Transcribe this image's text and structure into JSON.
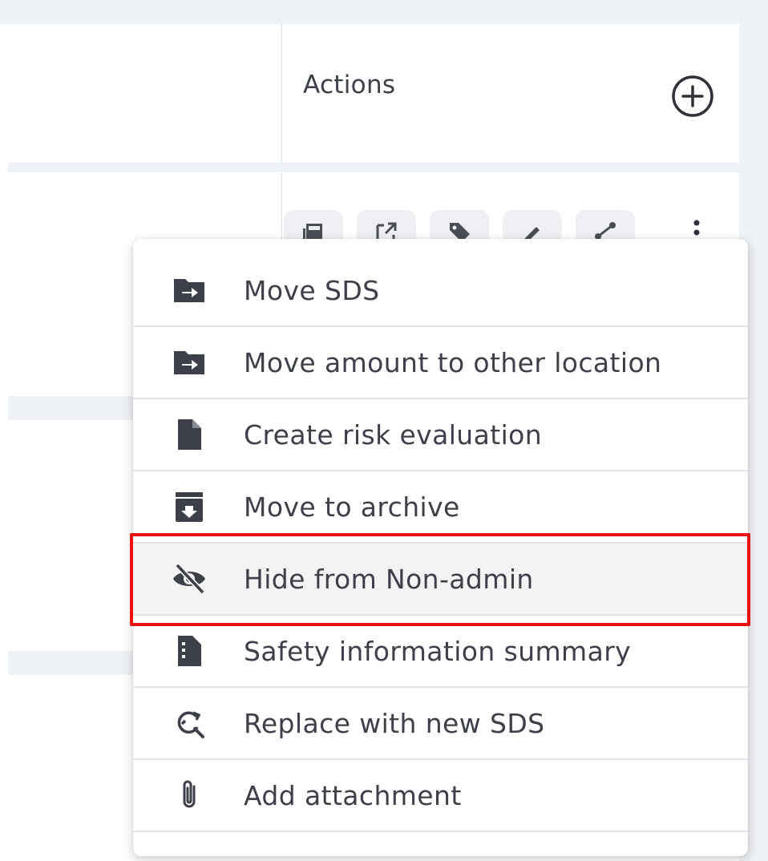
{
  "table": {
    "header": {
      "actions_label": "Actions",
      "add_icon": "plus-circle-icon"
    },
    "row_actions": {
      "icons": [
        "pdf-icon",
        "open-external-icon",
        "tag-icon",
        "edit-icon",
        "share-icon"
      ],
      "more_icon": "kebab-icon"
    }
  },
  "menu": {
    "items": [
      {
        "label": "Move SDS",
        "icon": "folder-move-icon"
      },
      {
        "label": "Move amount to other location",
        "icon": "folder-move-icon"
      },
      {
        "label": "Create risk evaluation",
        "icon": "file-icon"
      },
      {
        "label": "Move to archive",
        "icon": "archive-icon"
      },
      {
        "label": "Hide from Non-admin",
        "icon": "eye-off-icon",
        "highlighted": true
      },
      {
        "label": "Safety information summary",
        "icon": "file-summary-icon"
      },
      {
        "label": "Replace with new SDS",
        "icon": "search-refresh-icon"
      },
      {
        "label": "Add attachment",
        "icon": "paperclip-icon"
      }
    ]
  },
  "colors": {
    "text": "#3d4048",
    "icon": "#3d4048",
    "highlight_border": "#ee1111",
    "highlight_bg": "#f3f3f3",
    "divider": "#e1e4e8",
    "page_bg": "#eef1f5"
  }
}
